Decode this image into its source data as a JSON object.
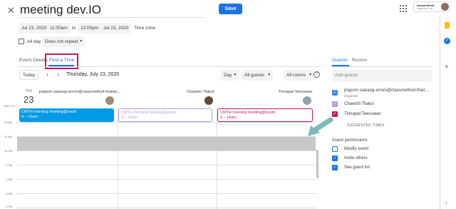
{
  "header": {
    "title": "meeting dev.IO",
    "save_label": "Save",
    "brand_line1": "classmethod",
    "brand_line2": "Thailand Co.,Ltd."
  },
  "datetime": {
    "start_date": "Jul 23, 2020",
    "start_time": "11:00am",
    "to_label": "to",
    "end_time": "12:00pm",
    "end_date": "Jul 23, 2020",
    "timezone_label": "Time zone",
    "allday_label": "All day",
    "repeat_label": "Does not repeat"
  },
  "tabs": {
    "event_details": "Event Details",
    "find_a_time": "Find a Time"
  },
  "toolbar": {
    "today_label": "Today",
    "date_label": "Thursday, July 23, 2020",
    "view_label": "Day",
    "guests_filter": "All guests",
    "rooms_filter": "All rooms"
  },
  "calendar": {
    "day_short": "THU",
    "day_num": "23",
    "tz_label": "GMT+07",
    "columns": [
      {
        "name": "jiraporn.sawang-arrom@classmethod-thailan..."
      },
      {
        "name": "Chawish Tilakul"
      },
      {
        "name": "Tinnapat Teesuwan"
      }
    ],
    "events": [
      {
        "title": "CMTH morning meeting@zoom",
        "time": "9 – 10am"
      },
      {
        "title": "CMTH morning meeting@zoom",
        "time": "9 – 10am"
      },
      {
        "title": "CMTH morning meeting@zoom",
        "time": "9 – 10am"
      }
    ],
    "hours": [
      "10 AM",
      "11 AM",
      "12 PM",
      "1 PM",
      "2 PM",
      "3 PM",
      "4 PM"
    ]
  },
  "guests_panel": {
    "tab_guests": "Guests",
    "tab_rooms": "Rooms",
    "add_placeholder": "Add guests",
    "guests": [
      {
        "name": "jiraporn.sawang-arrom@classmethod-thail...",
        "role": "Organizer",
        "color": "#4285f4"
      },
      {
        "name": "Chawish Tilakul",
        "role": "",
        "color": "#b39ddb"
      },
      {
        "name": "Tinnapat Teesuwan",
        "role": "",
        "color": "#c2185b"
      }
    ],
    "suggested_label": "SUGGESTED TIMES",
    "permissions_title": "Guest permissions",
    "permissions": [
      {
        "label": "Modify event",
        "checked": false
      },
      {
        "label": "Invite others",
        "checked": true
      },
      {
        "label": "See guest list",
        "checked": true
      }
    ]
  },
  "colors": {
    "accent": "#1a73e8",
    "highlight_box": "#c2185b",
    "arrow": "#7fb8b8",
    "selection": "#c8c8c8"
  }
}
